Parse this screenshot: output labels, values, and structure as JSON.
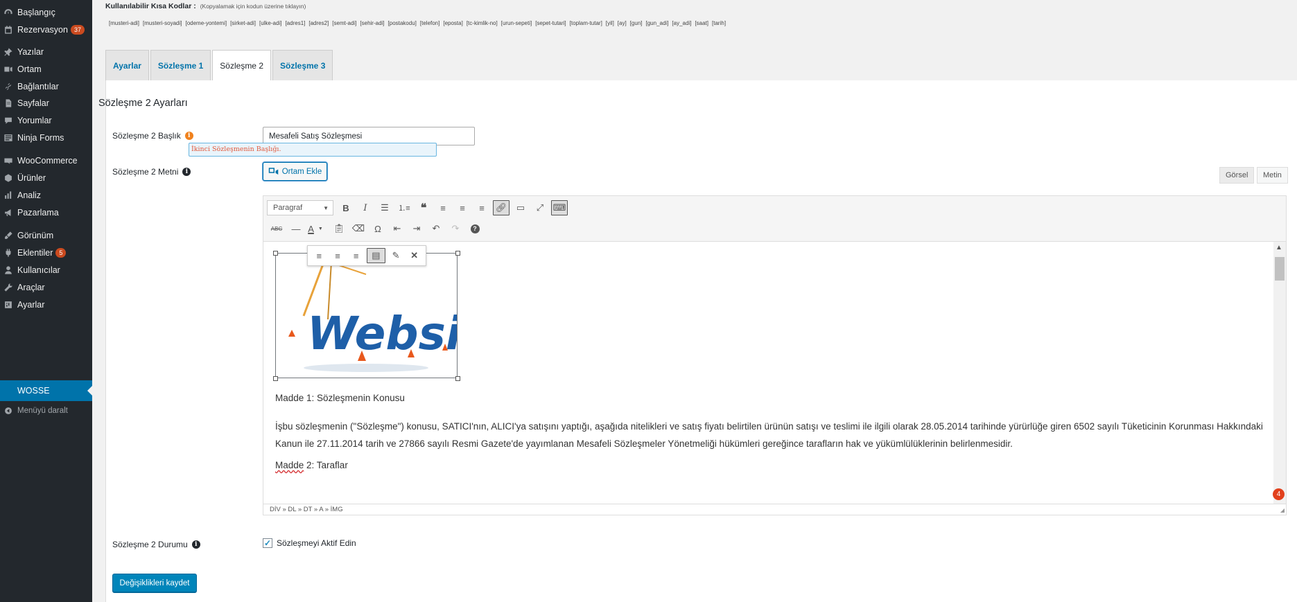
{
  "sidebar": {
    "items": [
      {
        "label": "Başlangıç",
        "icon": "dashboard-icon"
      },
      {
        "label": "Rezervasyon",
        "icon": "calendar-icon",
        "badge": "37"
      },
      {
        "label": "Yazılar",
        "icon": "pin-icon"
      },
      {
        "label": "Ortam",
        "icon": "media-icon"
      },
      {
        "label": "Bağlantılar",
        "icon": "link-icon"
      },
      {
        "label": "Sayfalar",
        "icon": "page-icon"
      },
      {
        "label": "Yorumlar",
        "icon": "comment-icon"
      },
      {
        "label": "Ninja Forms",
        "icon": "forms-icon"
      },
      {
        "label": "WooCommerce",
        "icon": "woo-icon"
      },
      {
        "label": "Ürünler",
        "icon": "box-icon"
      },
      {
        "label": "Analiz",
        "icon": "chart-icon"
      },
      {
        "label": "Pazarlama",
        "icon": "megaphone-icon"
      },
      {
        "label": "Görünüm",
        "icon": "brush-icon"
      },
      {
        "label": "Eklentiler",
        "icon": "plugin-icon",
        "badge": "5"
      },
      {
        "label": "Kullanıcılar",
        "icon": "user-icon"
      },
      {
        "label": "Araçlar",
        "icon": "wrench-icon"
      },
      {
        "label": "Ayarlar",
        "icon": "settings-icon"
      },
      {
        "label": "WOSSE",
        "icon": "",
        "current": true
      },
      {
        "label": "Menüyü daralt",
        "icon": "collapse-icon"
      }
    ]
  },
  "shortcodes": {
    "title": "Kullanılabilir Kısa Kodlar :",
    "hint": "(Kopyalamak için kodun üzerine tıklayın)",
    "codes": [
      "[musteri-adi]",
      "[musteri-soyadi]",
      "[odeme-yontemi]",
      "[sirket-adi]",
      "[ulke-adi]",
      "[adres1]",
      "[adres2]",
      "[semt-adi]",
      "[sehir-adi]",
      "[postakodu]",
      "[telefon]",
      "[eposta]",
      "[tc-kimlik-no]",
      "[urun-sepeti]",
      "[sepet-tutari]",
      "[toplam-tutar]",
      "[yil]",
      "[ay]",
      "[gun]",
      "[gun_adi]",
      "[ay_adi]",
      "[saat]",
      "[tarih]"
    ]
  },
  "tabs": [
    {
      "label": "Ayarlar",
      "active": false
    },
    {
      "label": "Sözleşme 1",
      "active": false
    },
    {
      "label": "Sözleşme 2",
      "active": true
    },
    {
      "label": "Sözleşme 3",
      "active": false
    }
  ],
  "section": {
    "title": "Sözleşme 2 Ayarları"
  },
  "fields": {
    "title_label": "Sözleşme 2 Başlık",
    "title_value": "Mesafeli Satış Sözleşmesi",
    "title_tooltip": "İkinci Sözleşmenin Başlığı.",
    "text_label": "Sözleşme 2 Metni",
    "status_label": "Sözleşme 2 Durumu",
    "status_checkbox_label": "Sözleşmeyi Aktif Edin",
    "status_checked": true
  },
  "editor": {
    "media_button": "Ortam Ekle",
    "mode_visual": "Görsel",
    "mode_text": "Metin",
    "format_select": "Paragraf",
    "image_text": "Website",
    "paragraphs": {
      "p1": "Madde 1: Sözleşmenin Konusu",
      "p2": "İşbu sözleşmenin (\"Sözleşme\") konusu, SATICI'nın, ALICI'ya satışını yaptığı, aşağıda nitelikleri ve satış fiyatı belirtilen ürünün satışı ve teslimi ile ilgili olarak 28.05.2014 tarihinde yürürlüğe giren 6502 sayılı Tüketicinin Korunması Hakkındaki Kanun ile 27.11.2014 tarih ve 27866 sayılı Resmi Gazete'de yayımlanan Mesafeli Sözleşmeler Yönetmeliği hükümleri gereğince tarafların hak ve yükümlülüklerinin belirlenmesidir.",
      "p3_word": "Madde",
      "p3_rest": " 2: Taraflar"
    },
    "statusbar": "DİV » DL » DT » A » İMG",
    "notification_count": "4"
  },
  "save_button": "Değişiklikleri kaydet",
  "colors": {
    "accent": "#0073aa",
    "sidebar_bg": "#23282d",
    "badge": "#ca4a1f"
  }
}
